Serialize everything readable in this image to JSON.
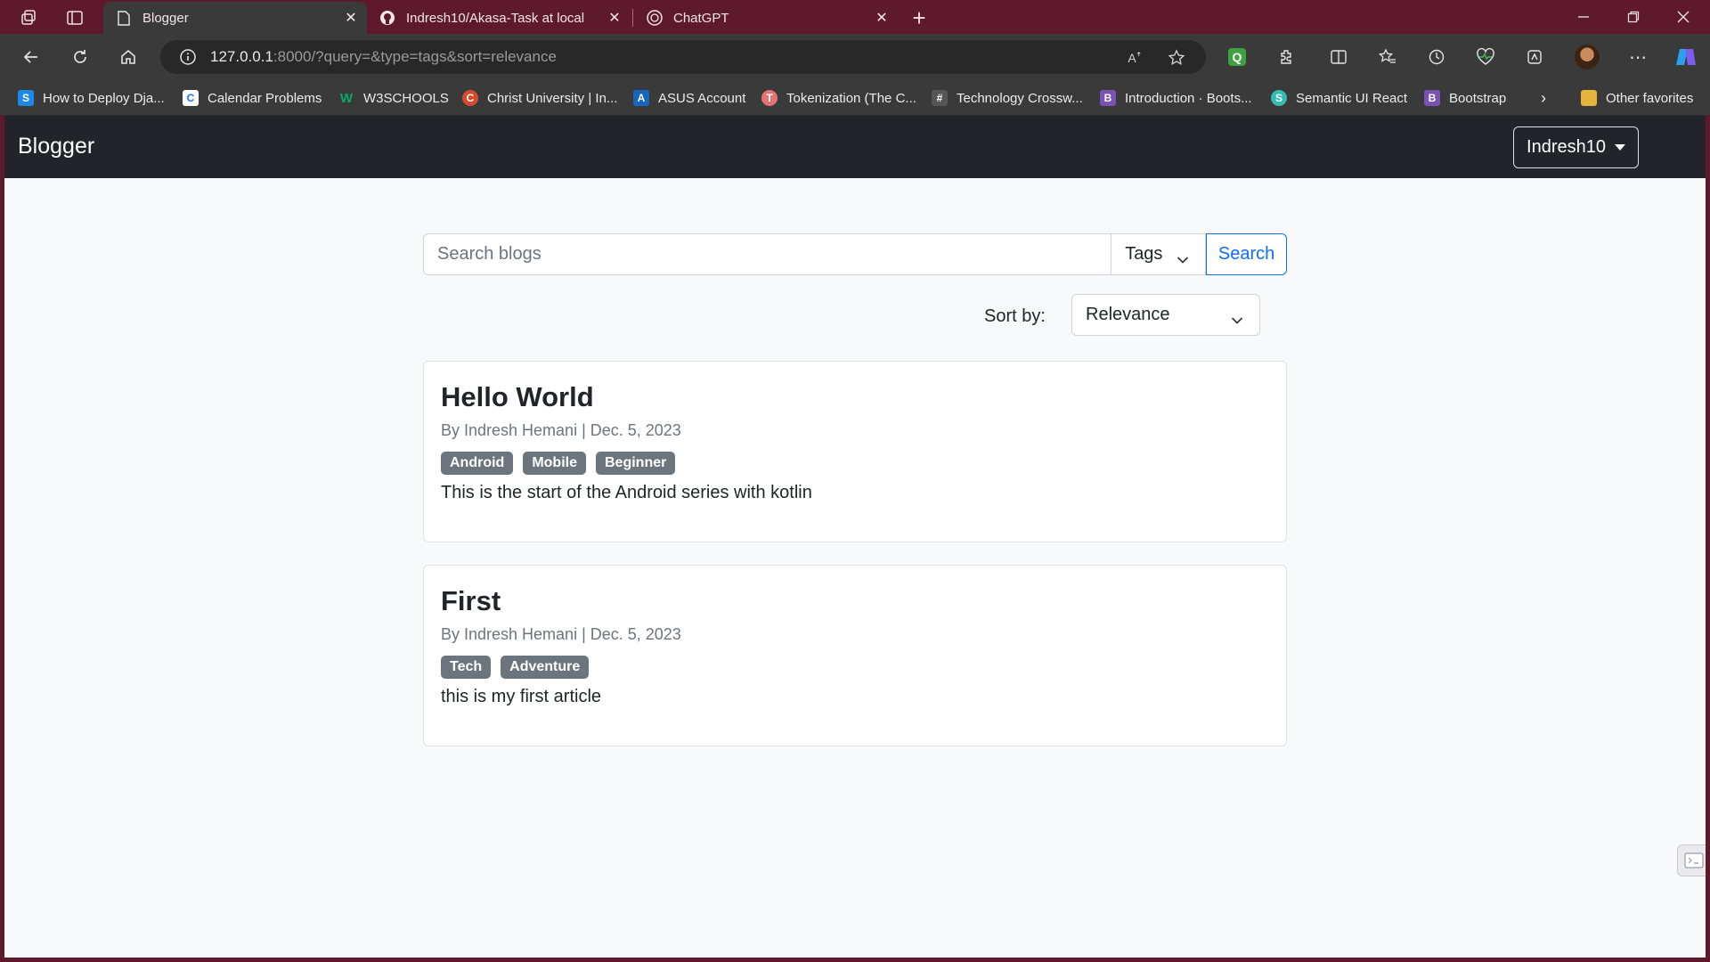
{
  "browser": {
    "tabs": [
      {
        "title": "Blogger",
        "active": true
      },
      {
        "title": "Indresh10/Akasa-Task at local",
        "active": false
      },
      {
        "title": "ChatGPT",
        "active": false
      }
    ],
    "address": {
      "host": "127.0.0.1",
      "path": ":8000/?query=&type=tags&sort=relevance"
    },
    "favorites": [
      {
        "label": "How to Deploy Dja...",
        "icon": "s-icon",
        "color": "#1e88e5",
        "glyph": "S"
      },
      {
        "label": "Calendar Problems",
        "icon": "calendar-icon",
        "color": "#1a73e8",
        "glyph": "C"
      },
      {
        "label": "W3SCHOOLS",
        "icon": "w3schools-icon",
        "color": "#04aa6d",
        "glyph": "W"
      },
      {
        "label": "Christ University | In...",
        "icon": "christ-university-icon",
        "color": "#d64a2e",
        "glyph": "C"
      },
      {
        "label": "ASUS Account",
        "icon": "asus-icon",
        "color": "#1565c0",
        "glyph": "A"
      },
      {
        "label": "Tokenization (The C...",
        "icon": "tokenization-icon",
        "color": "#e57373",
        "glyph": "T"
      },
      {
        "label": "Technology Crossw...",
        "icon": "crossword-icon",
        "color": "#555555",
        "glyph": "#"
      },
      {
        "label": "Introduction · Boots...",
        "icon": "bootstrap-icon",
        "color": "#7952b3",
        "glyph": "B"
      },
      {
        "label": "Semantic UI React",
        "icon": "semantic-ui-icon",
        "color": "#35bdb2",
        "glyph": "S"
      },
      {
        "label": "Bootstrap",
        "icon": "bootstrap-icon",
        "color": "#7952b3",
        "glyph": "B"
      }
    ],
    "other_favorites": "Other favorites"
  },
  "site": {
    "brand": "Blogger",
    "user": "Indresh10",
    "search": {
      "placeholder": "Search blogs",
      "value": "",
      "type_selected": "Tags",
      "button": "Search"
    },
    "sort": {
      "label": "Sort by:",
      "selected": "Relevance"
    },
    "posts": [
      {
        "title": "Hello World",
        "meta": "By Indresh Hemani | Dec. 5, 2023",
        "tags": [
          "Android",
          "Mobile",
          "Beginner"
        ],
        "excerpt": "This is the start of the Android series with kotlin"
      },
      {
        "title": "First",
        "meta": "By Indresh Hemani | Dec. 5, 2023",
        "tags": [
          "Tech",
          "Adventure"
        ],
        "excerpt": "this is my first article"
      }
    ]
  },
  "colors": {
    "title_bar": "#5e1a2c",
    "site_navbar": "#212529",
    "primary": "#0d6efd",
    "badge": "#6c757d"
  }
}
